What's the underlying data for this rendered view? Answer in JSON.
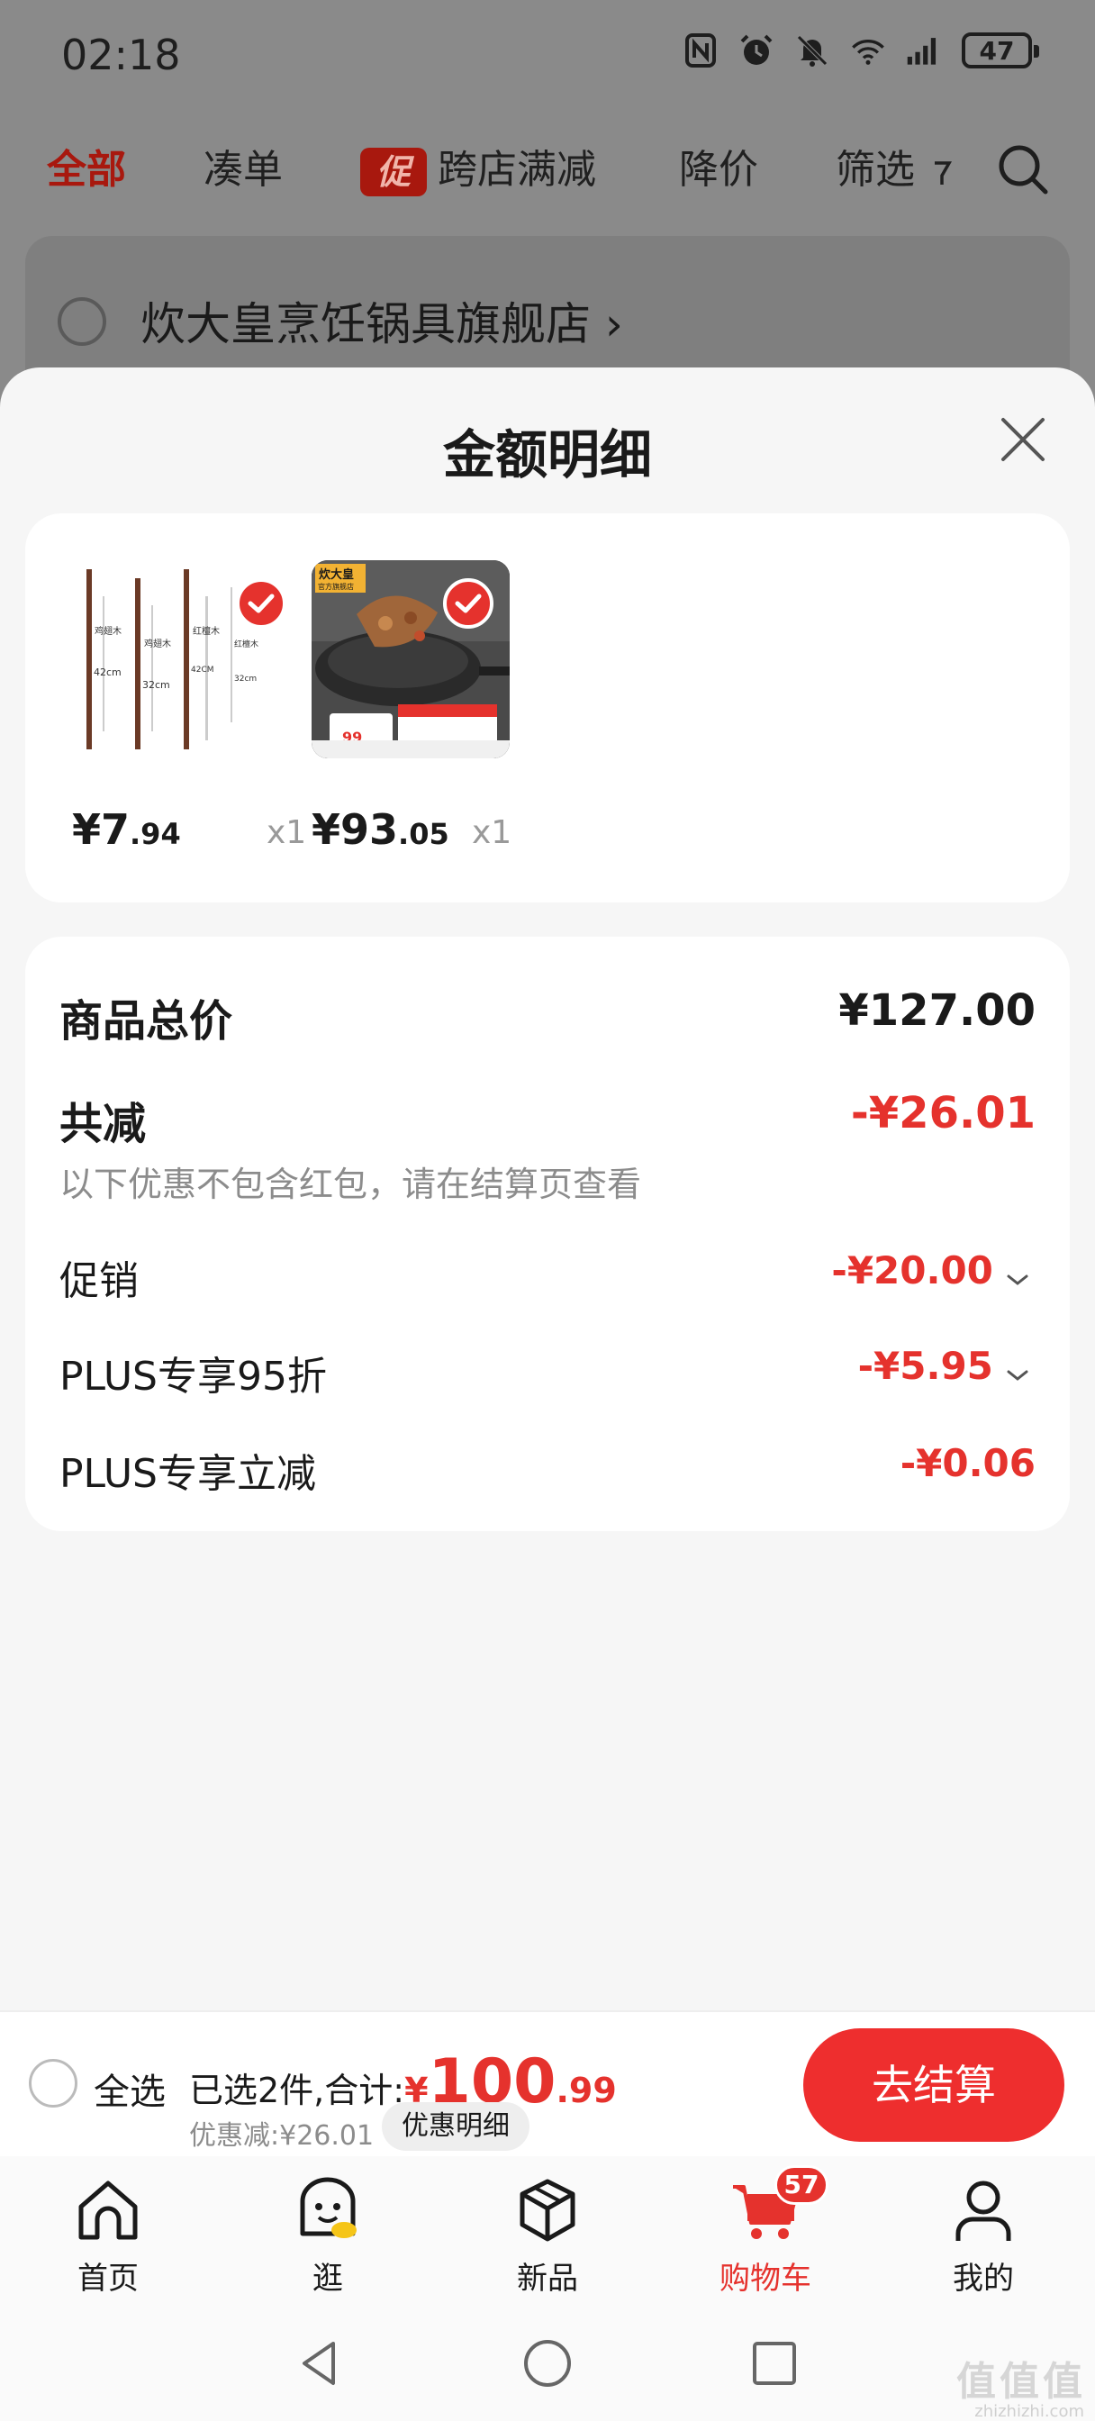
{
  "status_bar": {
    "time": "02:18",
    "battery": "47",
    "icons": [
      "nfc-icon",
      "alarm-icon",
      "mute-icon",
      "wifi-icon",
      "signal-icon",
      "battery-icon"
    ]
  },
  "cart_tabs": {
    "all": "全部",
    "bundle": "凑单",
    "promo_tag": "促",
    "cross_store": "跨店满减",
    "price_drop": "降价",
    "filter": "筛选"
  },
  "store": {
    "name": "炊大皇烹饪锅具旗舰店",
    "arrow": "›"
  },
  "sheet": {
    "title": "金额明细"
  },
  "products": [
    {
      "price_int": "¥7",
      "price_dec": ".94",
      "qty": "x1"
    },
    {
      "price_int": "¥93",
      "price_dec": ".05",
      "qty": "x1"
    }
  ],
  "chopsticks_labels": [
    "鸡翅木",
    "42cm",
    "鸡翅木",
    "32cm",
    "红檀木",
    "42CM",
    "红檀木",
    "32cm"
  ],
  "pan_labels": {
    "brand": "炊大皇",
    "store": "官方旗舰店",
    "price": "99"
  },
  "summary": {
    "total_label": "商品总价",
    "total_value": "¥127.00",
    "reduce_label": "共减",
    "reduce_value": "-¥26.01",
    "note": "以下优惠不包含红包，请在结算页查看",
    "items": [
      {
        "label": "促销",
        "value": "-¥20.00",
        "expandable": true
      },
      {
        "label": "PLUS专享95折",
        "value": "-¥5.95",
        "expandable": true
      },
      {
        "label": "PLUS专享立减",
        "value": "-¥0.06",
        "expandable": false
      }
    ]
  },
  "checkout": {
    "select_all": "全选",
    "selected_prefix": "已选2件,合计:",
    "currency": "¥",
    "sum_int": "100",
    "sum_dec": ".99",
    "discount": "优惠减:¥26.01",
    "detail_button": "优惠明细",
    "checkout_button": "去结算"
  },
  "tab_bar": {
    "items": [
      {
        "label": "首页",
        "icon": "home-icon"
      },
      {
        "label": "逛",
        "icon": "browse-icon"
      },
      {
        "label": "新品",
        "icon": "new-products-icon"
      },
      {
        "label": "购物车",
        "icon": "cart-icon",
        "badge": "57",
        "active": true
      },
      {
        "label": "我的",
        "icon": "profile-icon"
      }
    ]
  },
  "watermark": {
    "text": "值值值",
    "sub": "zhizhizhi.com"
  },
  "colors": {
    "accent_red": "#e5322d",
    "dark_red": "#a8180e",
    "overlay_gray": "#8a8a8a"
  }
}
